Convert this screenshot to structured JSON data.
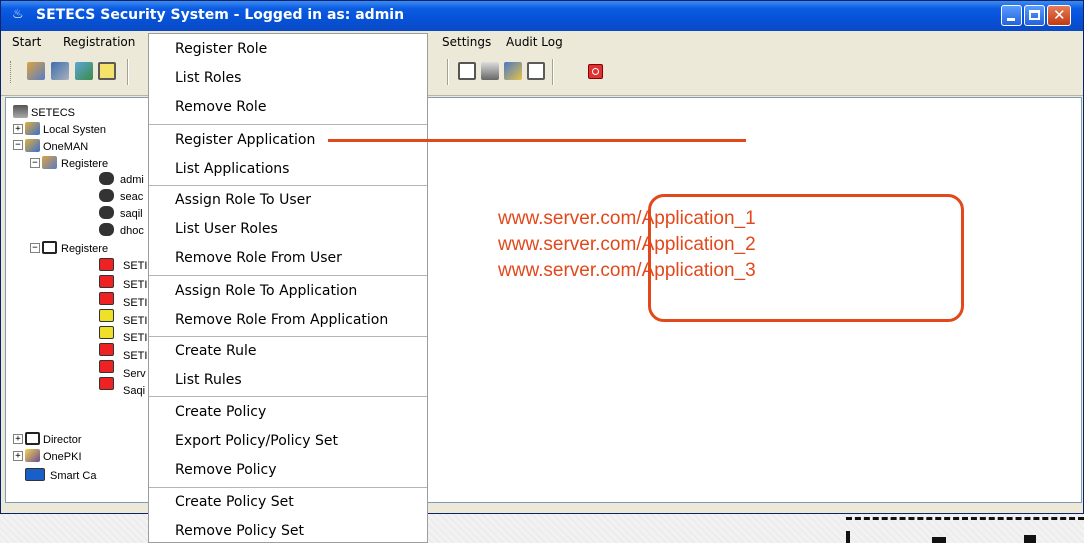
{
  "window": {
    "title": "SETECS Security System - Logged in as: admin",
    "title_icon": "java-cup-icon"
  },
  "menubar": {
    "items": [
      "Start",
      "Registration",
      "Settings",
      "Audit Log"
    ]
  },
  "tree": {
    "root": "SETECS",
    "nodes": [
      "Local Systen",
      "OneMAN",
      "Registere",
      "admi",
      "seac",
      "saqil",
      "dhoc",
      "Registere",
      "SETI",
      "SETI",
      "SETI",
      "SETI",
      "SETI",
      "SETI",
      "Serv",
      "Saqi",
      "Director",
      "OnePKI",
      "Smart Ca"
    ]
  },
  "dropdown": {
    "items": [
      "Register Role",
      "List Roles",
      "Remove Role",
      "Register Application",
      "List Applications",
      "Assign Role To User",
      "List User Roles",
      "Remove Role From User",
      "Assign Role To Application",
      "Remove Role From Application",
      "Create Rule",
      "List Rules",
      "Create Policy",
      "Export Policy/Policy Set",
      "Remove Policy",
      "Create Policy Set",
      "Remove Policy Set"
    ]
  },
  "annotation": {
    "urls": [
      "www.server.com/Application_1",
      "www.server.com/Application_2",
      "www.server.com/Application_3"
    ],
    "color": "#e2481b"
  },
  "colors": {
    "titlebar": "#0652d7",
    "chrome": "#ece9d8",
    "accent": "#e2481b"
  }
}
